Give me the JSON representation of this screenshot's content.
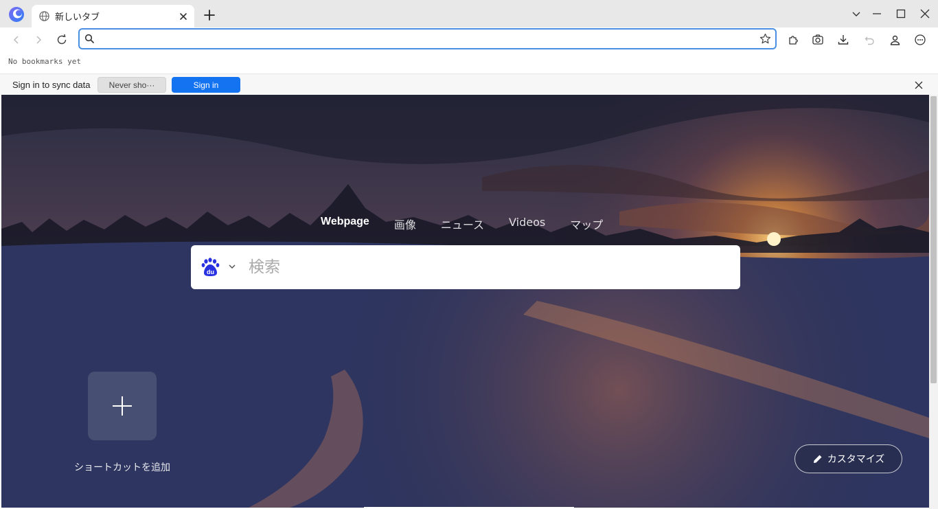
{
  "browser": {
    "tab": {
      "title": "新しいタブ"
    },
    "omnibox": {
      "value": "",
      "placeholder": ""
    },
    "bookmarks_bar": {
      "empty_text": "No bookmarks yet"
    },
    "sync_bar": {
      "message": "Sign in to sync data",
      "never_label": "Never sho···",
      "signin_label": "Sign in"
    },
    "icons": [
      "app-logo-icon",
      "globe-icon",
      "close-icon",
      "plus-icon",
      "chevron-down-icon",
      "minimize-icon",
      "maximize-icon",
      "back-icon",
      "forward-icon",
      "reload-icon",
      "search-icon",
      "star-icon",
      "extensions-icon",
      "screenshot-icon",
      "download-icon",
      "undo-icon",
      "profile-icon",
      "menu-icon"
    ],
    "accent_color": "#1473f0"
  },
  "newtab": {
    "search_tabs": [
      {
        "label": "Webpage",
        "active": true
      },
      {
        "label": "画像",
        "active": false
      },
      {
        "label": "ニュース",
        "active": false
      },
      {
        "label": "Videos",
        "active": false
      },
      {
        "label": "マップ",
        "active": false
      }
    ],
    "search": {
      "placeholder": "検索",
      "engine": "baidu-icon"
    },
    "shortcut": {
      "add_label": "ショートカットを追加"
    },
    "customize_label": "カスタマイズ"
  }
}
